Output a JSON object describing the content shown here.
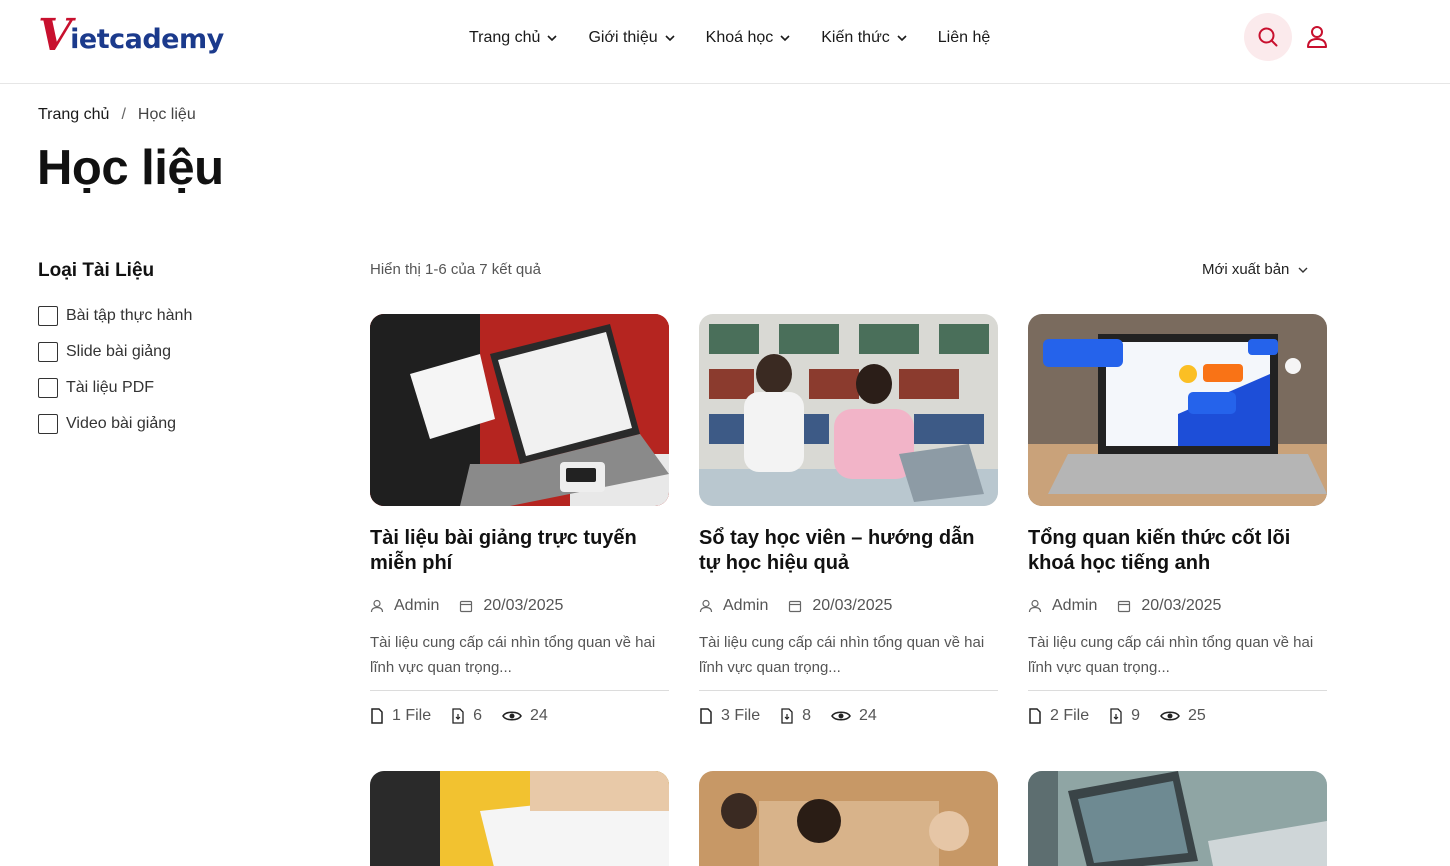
{
  "header": {
    "logo_v": "V",
    "logo_rest": "ietcademy",
    "nav": [
      {
        "label": "Trang chủ",
        "has_dropdown": true
      },
      {
        "label": "Giới thiệu",
        "has_dropdown": true
      },
      {
        "label": "Khoá học",
        "has_dropdown": true
      },
      {
        "label": "Kiến thức",
        "has_dropdown": true
      },
      {
        "label": "Liên hệ",
        "has_dropdown": false
      }
    ],
    "search_icon": "search-icon",
    "user_icon": "user-icon"
  },
  "breadcrumb": {
    "home": "Trang chủ",
    "separator": "/",
    "current": "Học liệu"
  },
  "page_title": "Học liệu",
  "filter": {
    "title": "Loại Tài Liệu",
    "options": [
      {
        "label": "Bài tập thực hành",
        "checked": false
      },
      {
        "label": "Slide bài giảng",
        "checked": false
      },
      {
        "label": "Tài liệu PDF",
        "checked": false
      },
      {
        "label": "Video bài giảng",
        "checked": false
      }
    ]
  },
  "results": {
    "count_text": "Hiển thị 1-6 của 7 kết quả",
    "sort_label": "Mới xuất bản"
  },
  "cards": [
    {
      "title": "Tài liệu bài giảng trực tuyến miễn phí",
      "author": "Admin",
      "date": "20/03/2025",
      "description": "Tài liệu cung cấp cái nhìn tổng quan về hai lĩnh vực quan trọng...",
      "files": "1 File",
      "downloads": "6",
      "views": "24"
    },
    {
      "title": "Sổ tay học viên – hướng dẫn tự học hiệu quả",
      "author": "Admin",
      "date": "20/03/2025",
      "description": "Tài liệu cung cấp cái nhìn tổng quan về hai lĩnh vực quan trọng...",
      "files": "3 File",
      "downloads": "8",
      "views": "24"
    },
    {
      "title": "Tổng quan kiến thức cốt lõi khoá học tiếng anh",
      "author": "Admin",
      "date": "20/03/2025",
      "description": "Tài liệu cung cấp cái nhìn tổng quan về hai lĩnh vực quan trọng...",
      "files": "2 File",
      "downloads": "9",
      "views": "25"
    }
  ],
  "colors": {
    "brand_red": "#c8102e",
    "brand_blue": "#1b3a8c",
    "search_bg": "#fbeaec"
  }
}
